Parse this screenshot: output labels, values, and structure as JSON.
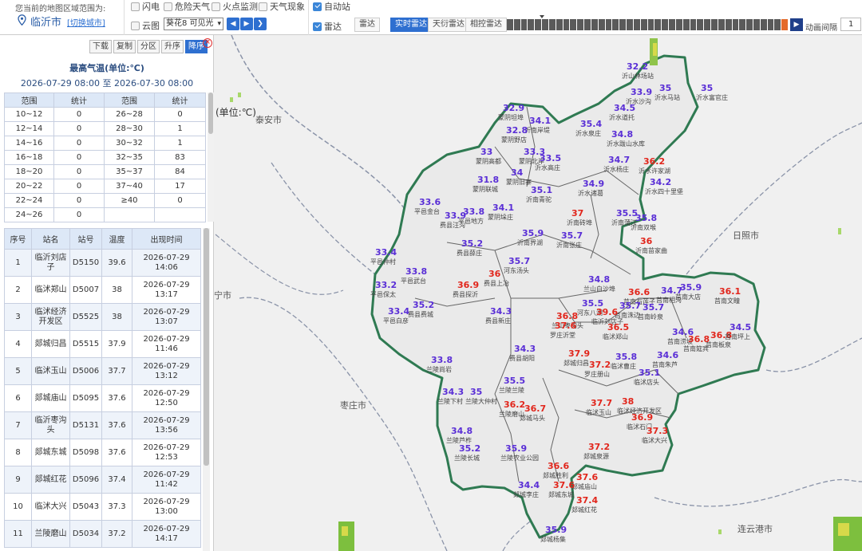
{
  "topbar": {
    "region_label": "您当前的地图区域范围为:",
    "city": "临沂市",
    "switch_city": "[切换城市]",
    "layers": {
      "lightning": "闪电",
      "severe_weather": "危险天气",
      "fire_monitor": "火点监测",
      "weather_phenomena": "天气现象",
      "cloud": "云图",
      "cloud_select": "葵花8 可见光",
      "auto_station": "自动站",
      "radar": "雷达"
    },
    "radar_tabs": [
      "雷达",
      "实时雷达",
      "天衍雷达",
      "相控雷达"
    ],
    "active_radar_tab": 1,
    "interval_label": "动画间隔",
    "interval_value": "1"
  },
  "panel": {
    "tools": [
      "下载",
      "复制",
      "分区",
      "升序",
      "降序"
    ],
    "active_tool": 4,
    "title": "最高气温(单位:℃)",
    "time_range": "2026-07-29 08:00 至 2026-07-30 08:00",
    "stats_header": [
      "范围",
      "统计",
      "范围",
      "统计"
    ],
    "stats_rows": [
      [
        "10~12",
        "0",
        "26~28",
        "0"
      ],
      [
        "12~14",
        "0",
        "28~30",
        "1"
      ],
      [
        "14~16",
        "0",
        "30~32",
        "1"
      ],
      [
        "16~18",
        "0",
        "32~35",
        "83"
      ],
      [
        "18~20",
        "0",
        "35~37",
        "84"
      ],
      [
        "20~22",
        "0",
        "37~40",
        "17"
      ],
      [
        "22~24",
        "0",
        "≥40",
        "0"
      ],
      [
        "24~26",
        "0",
        "",
        ""
      ]
    ],
    "detail_header": [
      "序号",
      "站名",
      "站号",
      "温度",
      "出现时间"
    ],
    "detail_rows": [
      [
        "1",
        "临沂刘店子",
        "D5150",
        "39.6",
        "2026-07-29 14:06"
      ],
      [
        "2",
        "临沭郑山",
        "D5007",
        "38",
        "2026-07-29 13:17"
      ],
      [
        "3",
        "临沭经济开发区",
        "D5525",
        "38",
        "2026-07-29 13:07"
      ],
      [
        "4",
        "郯城归昌",
        "D5515",
        "37.9",
        "2026-07-29 11:46"
      ],
      [
        "5",
        "临沭玉山",
        "D5006",
        "37.7",
        "2026-07-29 13:12"
      ],
      [
        "6",
        "郯城庙山",
        "D5095",
        "37.6",
        "2026-07-29 12:50"
      ],
      [
        "7",
        "临沂枣沟头",
        "D5131",
        "37.6",
        "2026-07-29 13:56"
      ],
      [
        "8",
        "郯城东城",
        "D5098",
        "37.6",
        "2026-07-29 12:53"
      ],
      [
        "9",
        "郯城红花",
        "D5096",
        "37.4",
        "2026-07-29 11:42"
      ],
      [
        "10",
        "临沭大兴",
        "D5043",
        "37.3",
        "2026-07-29 13:00"
      ],
      [
        "11",
        "兰陵磨山",
        "D5034",
        "37.2",
        "2026-07-29 14:17"
      ]
    ]
  },
  "map": {
    "unit_label": "(单位:℃)",
    "places": [
      "泰安市",
      "日照市",
      "枣庄市",
      "连云港市",
      "宁市"
    ],
    "temperature_color_normal": "#5a2fd6",
    "temperature_color_high": "#e1261c",
    "stations": [
      {
        "v": "32.2",
        "hot": false,
        "name": "沂山林场站"
      },
      {
        "v": "33.9",
        "hot": false,
        "name": "沂水沙沟"
      },
      {
        "v": "35",
        "hot": false,
        "name": "沂水马站"
      },
      {
        "v": "35",
        "hot": false,
        "name": "沂水富官庄"
      },
      {
        "v": "34.5",
        "hot": false,
        "name": "沂水道托"
      },
      {
        "v": "32.9",
        "hot": false,
        "name": "蒙阴坦埠"
      },
      {
        "v": "34.1",
        "hot": false,
        "name": "沂南岸堤"
      },
      {
        "v": "35.4",
        "hot": false,
        "name": "沂水泉庄"
      },
      {
        "v": "34.8",
        "hot": false,
        "name": "沂水跋山水库"
      },
      {
        "v": "32.8",
        "hot": false,
        "name": "蒙阴野店"
      },
      {
        "v": "33.3",
        "hot": false,
        "name": "蒙阴北岸"
      },
      {
        "v": "33",
        "hot": false,
        "name": "蒙阴高都"
      },
      {
        "v": "34",
        "hot": false,
        "name": "蒙阴旧寨"
      },
      {
        "v": "33.5",
        "hot": false,
        "name": "沂水高庄"
      },
      {
        "v": "36.2",
        "hot": true,
        "name": "沂水许家湖"
      },
      {
        "v": "34.7",
        "hot": false,
        "name": "沂水杨庄"
      },
      {
        "v": "34.2",
        "hot": false,
        "name": "沂水四十里堡"
      },
      {
        "v": "31.8",
        "hot": false,
        "name": "蒙阴联城"
      },
      {
        "v": "34.9",
        "hot": false,
        "name": "沂水诸葛"
      },
      {
        "v": "35.1",
        "hot": false,
        "name": "沂南青驼"
      },
      {
        "v": "33.6",
        "hot": false,
        "name": "平邑金台"
      },
      {
        "v": "34.1",
        "hot": false,
        "name": "蒙阴垛庄"
      },
      {
        "v": "37",
        "hot": true,
        "name": "沂南砖埠"
      },
      {
        "v": "35.5",
        "hot": false,
        "name": "沂南蒲汪"
      },
      {
        "v": "35.8",
        "hot": false,
        "name": "沂南双堠"
      },
      {
        "v": "33.8",
        "hot": false,
        "name": "平邑地方"
      },
      {
        "v": "33.9",
        "hot": false,
        "name": "费县汪沟"
      },
      {
        "v": "35.9",
        "hot": false,
        "name": "沂南界湖"
      },
      {
        "v": "35.7",
        "hot": false,
        "name": "沂南张庄"
      },
      {
        "v": "36",
        "hot": true,
        "name": "沂南苗家曲"
      },
      {
        "v": "33.4",
        "hot": false,
        "name": "平邑仲村"
      },
      {
        "v": "35.2",
        "hot": false,
        "name": "费县薛庄"
      },
      {
        "v": "35.7",
        "hot": false,
        "name": "河东汤头"
      },
      {
        "v": "33.8",
        "hot": false,
        "name": "平邑武台"
      },
      {
        "v": "33.2",
        "hot": false,
        "name": "平邑保太"
      },
      {
        "v": "36.9",
        "hot": true,
        "name": "费县探沂"
      },
      {
        "v": "36",
        "hot": true,
        "name": "费县上冶"
      },
      {
        "v": "34.8",
        "hot": false,
        "name": "兰山白沙埠"
      },
      {
        "v": "36.6",
        "hot": true,
        "name": "莒南石莲子"
      },
      {
        "v": "34.7",
        "hot": false,
        "name": "莒南相沟"
      },
      {
        "v": "35.9",
        "hot": false,
        "name": "莒南大店"
      },
      {
        "v": "36.1",
        "hot": true,
        "name": "莒南文疃"
      },
      {
        "v": "33.4",
        "hot": false,
        "name": "平邑白彦"
      },
      {
        "v": "35.2",
        "hot": false,
        "name": "费县费城"
      },
      {
        "v": "34.3",
        "hot": false,
        "name": "费县新庄"
      },
      {
        "v": "36.8",
        "hot": true,
        "name": "兰山枣沟头"
      },
      {
        "v": "35.5",
        "hot": false,
        "name": "河东八湖"
      },
      {
        "v": "35.7",
        "hot": false,
        "name": "莒南洙边"
      },
      {
        "v": "35.7",
        "hot": false,
        "name": "莒南岭泉"
      },
      {
        "v": "39.6",
        "hot": true,
        "name": "临沂刘店子"
      },
      {
        "v": "36.5",
        "hot": true,
        "name": "临沭郑山"
      },
      {
        "v": "34.6",
        "hot": false,
        "name": "莒南涝坡"
      },
      {
        "v": "36.8",
        "hot": true,
        "name": "莒南板泉"
      },
      {
        "v": "34.5",
        "hot": false,
        "name": "莒南坪上"
      },
      {
        "v": "37.6",
        "hot": true,
        "name": "罗庄沂堂"
      },
      {
        "v": "34.3",
        "hot": false,
        "name": "费县胡阳"
      },
      {
        "v": "33.8",
        "hot": false,
        "name": "兰陵尚岩"
      },
      {
        "v": "37.9",
        "hot": true,
        "name": "郯城归昌"
      },
      {
        "v": "35.8",
        "hot": false,
        "name": "临沭曹庄"
      },
      {
        "v": "35.1",
        "hot": false,
        "name": "临沭店头"
      },
      {
        "v": "34.6",
        "hot": false,
        "name": "莒南朱芦"
      },
      {
        "v": "36.8",
        "hot": true,
        "name": "莒南筵宾"
      },
      {
        "v": "35.5",
        "hot": false,
        "name": "兰陵兰陵"
      },
      {
        "v": "37.2",
        "hot": true,
        "name": "罗庄册山"
      },
      {
        "v": "34.3",
        "hot": false,
        "name": "兰陵下村"
      },
      {
        "v": "35",
        "hot": false,
        "name": "兰陵大仲村"
      },
      {
        "v": "36.2",
        "hot": true,
        "name": "兰陵磨山"
      },
      {
        "v": "36.7",
        "hot": true,
        "name": "郯城马头"
      },
      {
        "v": "37.7",
        "hot": true,
        "name": "临沭玉山"
      },
      {
        "v": "38",
        "hot": true,
        "name": "临沭经济开发区"
      },
      {
        "v": "36.9",
        "hot": true,
        "name": "临沭石门"
      },
      {
        "v": "37.3",
        "hot": true,
        "name": "临沭大兴"
      },
      {
        "v": "34.8",
        "hot": false,
        "name": "兰陵芦柞"
      },
      {
        "v": "35.2",
        "hot": false,
        "name": "兰陵长城"
      },
      {
        "v": "35.9",
        "hot": false,
        "name": "兰陵农业公园"
      },
      {
        "v": "37.6",
        "hot": true,
        "name": "郯城庙山"
      },
      {
        "v": "37.2",
        "hot": true,
        "name": "郯城泉源"
      },
      {
        "v": "36.6",
        "hot": true,
        "name": "郯城胜利"
      },
      {
        "v": "37.6",
        "hot": true,
        "name": "郯城东城"
      },
      {
        "v": "37.4",
        "hot": true,
        "name": "郯城红花"
      },
      {
        "v": "34.4",
        "hot": false,
        "name": "郯城李庄"
      },
      {
        "v": "35.9",
        "hot": false,
        "name": "郯城杨集"
      }
    ]
  }
}
